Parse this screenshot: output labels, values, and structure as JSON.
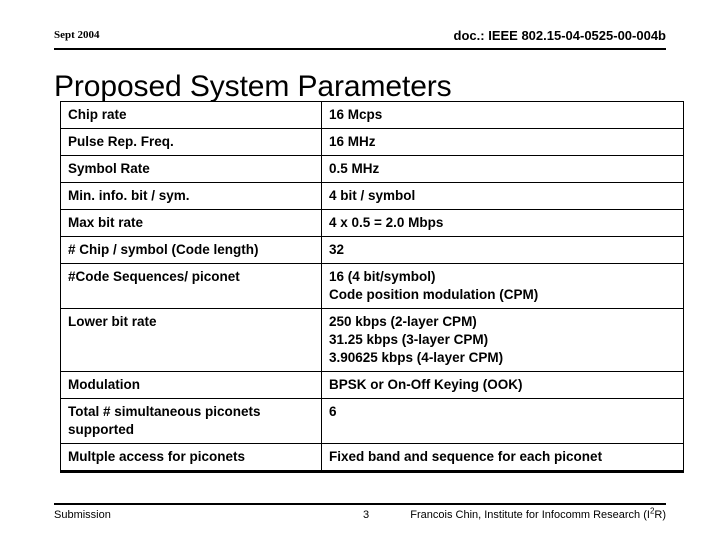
{
  "header": {
    "left": "Sept 2004",
    "right": "doc.: IEEE 802.15-04-0525-00-004b"
  },
  "title": "Proposed System Parameters",
  "table": {
    "rows": [
      {
        "parameter": "Chip rate",
        "value_lines": [
          "16 Mcps"
        ]
      },
      {
        "parameter": "Pulse Rep. Freq.",
        "value_lines": [
          "16 MHz"
        ]
      },
      {
        "parameter": "Symbol Rate",
        "value_lines": [
          "0.5 MHz"
        ]
      },
      {
        "parameter": "Min. info. bit / sym.",
        "value_lines": [
          "4 bit / symbol"
        ]
      },
      {
        "parameter": "Max bit rate",
        "value_lines": [
          "4 x 0.5 = 2.0 Mbps"
        ]
      },
      {
        "parameter": "# Chip / symbol (Code length)",
        "value_lines": [
          "32"
        ]
      },
      {
        "parameter": "#Code Sequences/ piconet",
        "value_lines": [
          "16 (4 bit/symbol)",
          "Code position modulation (CPM)"
        ]
      },
      {
        "parameter": "Lower bit rate",
        "value_lines": [
          "250 kbps (2-layer CPM)",
          "31.25 kbps (3-layer CPM)",
          "3.90625 kbps (4-layer CPM)"
        ]
      },
      {
        "parameter": "Modulation",
        "value_lines": [
          "BPSK or On-Off Keying (OOK)"
        ]
      },
      {
        "parameter": "Total # simultaneous piconets supported",
        "value_lines": [
          "6"
        ]
      },
      {
        "parameter": "Multple access for piconets",
        "value_lines": [
          "Fixed band and sequence for each piconet"
        ]
      }
    ]
  },
  "footer": {
    "left": "Submission",
    "page": "3",
    "right_prefix": "Francois Chin, Institute for Infocomm Research (I",
    "right_sup": "2",
    "right_suffix": "R)"
  }
}
